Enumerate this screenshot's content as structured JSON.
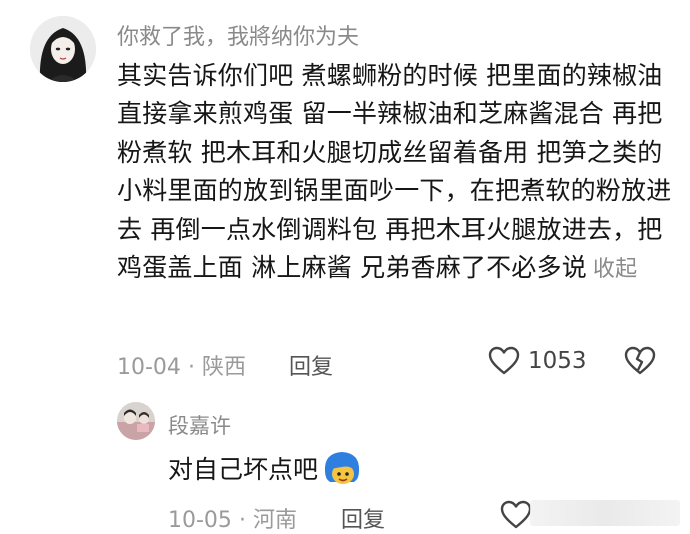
{
  "comment": {
    "username": "你救了我，我將纳你为夫",
    "text": "其实告诉你们吧 煮螺蛳粉的时候 把里面的辣椒油直接拿来煎鸡蛋 留一半辣椒油和芝麻酱混合 再把粉煮软 把木耳和火腿切成丝留着备用 把笋之类的小料里面的放到锅里面吵一下，在把煮软的粉放进去 再倒一点水倒调料包 再把木耳火腿放进去，把鸡蛋盖上面 淋上麻酱 兄弟香麻了不必多说",
    "collapse_label": "收起",
    "date": "10-04",
    "location": "陕西",
    "reply_label": "回复",
    "like_count": "1053"
  },
  "reply": {
    "username": "段嘉许",
    "text": "对自己坏点吧",
    "date": "10-05",
    "location": "河南",
    "reply_label": "回复"
  },
  "icons": {
    "like": "heart-outline-icon",
    "dislike": "broken-heart-icon",
    "emoji": "blue-hair-emoji-icon"
  },
  "colors": {
    "text": "#161616",
    "meta": "#9a9a9a",
    "emoji_blue": "#2f7fe0"
  }
}
